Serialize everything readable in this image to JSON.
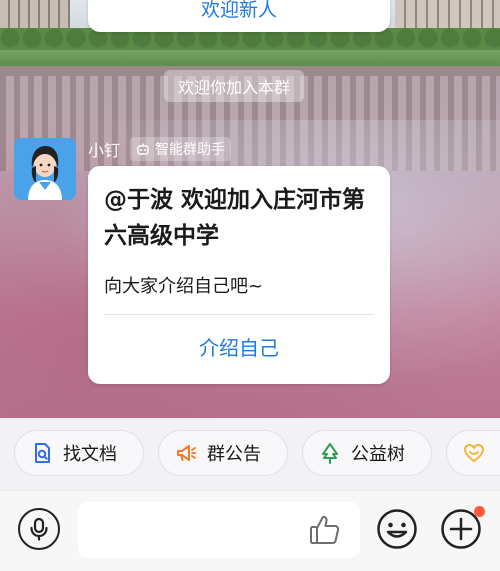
{
  "top_card": {
    "link_text": "欢迎新人"
  },
  "system_notice": "欢迎你加入本群",
  "sender": {
    "name": "小钉",
    "tag": "智能群助手",
    "tag_icon": "robot-icon"
  },
  "message": {
    "title": "@于波  欢迎加入庄河市第六高级中学",
    "body": "向大家介绍自己吧~",
    "action": "介绍自己"
  },
  "quick_actions": [
    {
      "label": "找文档",
      "icon": "document-search-icon",
      "color": "#2f6fe0"
    },
    {
      "label": "群公告",
      "icon": "megaphone-icon",
      "color": "#f07a2a"
    },
    {
      "label": "公益树",
      "icon": "tree-icon",
      "color": "#2f9e57"
    },
    {
      "label": "",
      "icon": "heart-icon",
      "color": "#f2b53a"
    }
  ],
  "input_bar": {
    "voice_icon": "microphone-icon",
    "like_icon": "thumbs-up-icon",
    "emoji_icon": "emoji-icon",
    "plus_icon": "plus-icon",
    "notification_dot_color": "#ff5a3c"
  },
  "colors": {
    "accent": "#1f7ae0"
  }
}
